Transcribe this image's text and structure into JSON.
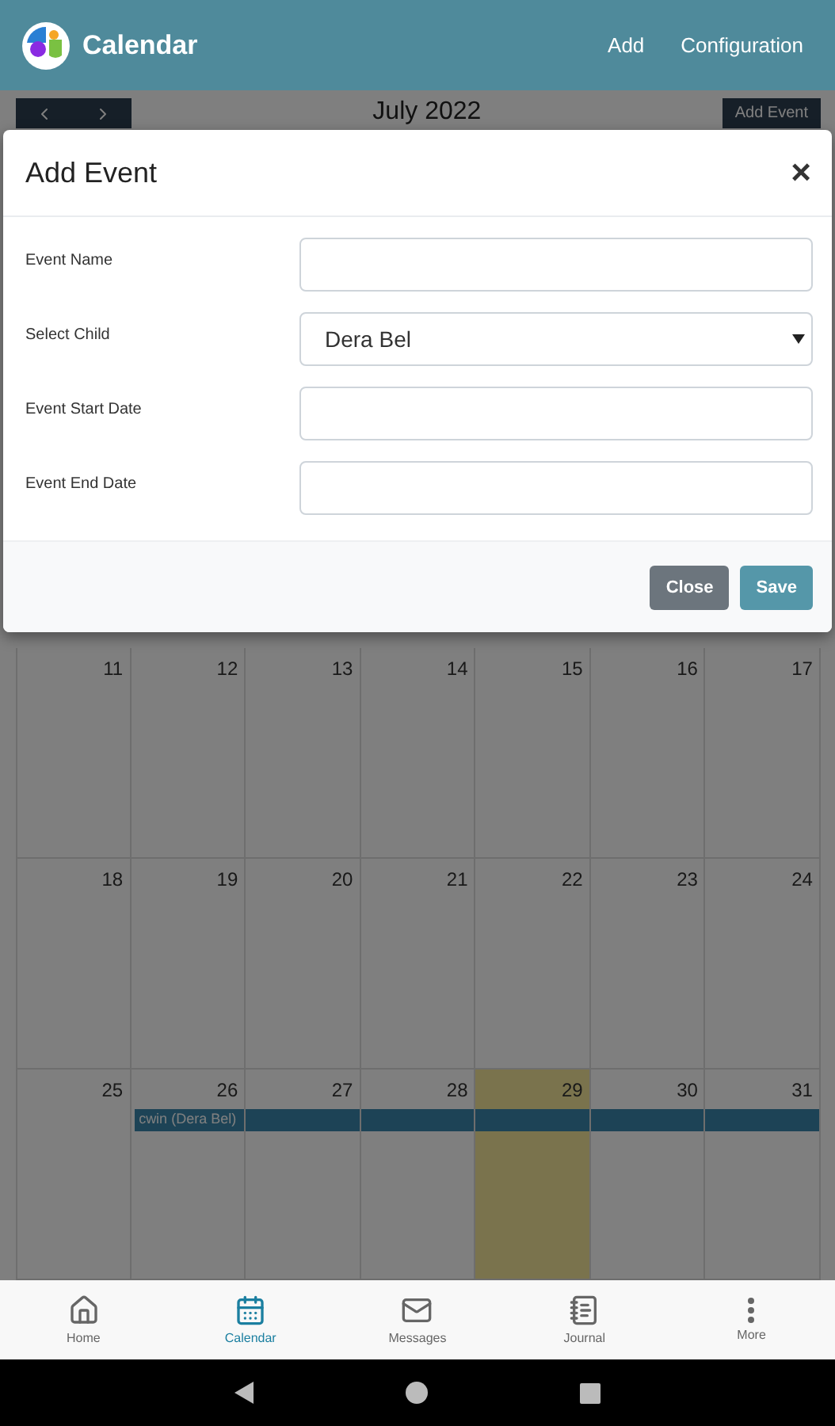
{
  "header": {
    "title": "Calendar",
    "actions": [
      "Add",
      "Configuration"
    ]
  },
  "calendar": {
    "month": "July 2022",
    "add_button": "Add Event",
    "weeks": [
      {
        "days": [
          {
            "day": "11",
            "today": false
          },
          {
            "day": "12",
            "today": false
          },
          {
            "day": "13",
            "today": false
          },
          {
            "day": "14",
            "today": false
          },
          {
            "day": "15",
            "today": false
          },
          {
            "day": "16",
            "today": false
          },
          {
            "day": "17",
            "today": false
          }
        ]
      },
      {
        "days": [
          {
            "day": "18",
            "today": false
          },
          {
            "day": "19",
            "today": false
          },
          {
            "day": "20",
            "today": false
          },
          {
            "day": "21",
            "today": false
          },
          {
            "day": "22",
            "today": false
          },
          {
            "day": "23",
            "today": false
          },
          {
            "day": "24",
            "today": false
          }
        ]
      },
      {
        "days": [
          {
            "day": "25",
            "today": false
          },
          {
            "day": "26",
            "today": false,
            "event": "cwin (Dera Bel)"
          },
          {
            "day": "27",
            "today": false
          },
          {
            "day": "28",
            "today": false
          },
          {
            "day": "29",
            "today": true
          },
          {
            "day": "30",
            "today": false
          },
          {
            "day": "31",
            "today": false
          }
        ]
      }
    ]
  },
  "modal": {
    "title": "Add Event",
    "close": "×",
    "fields": [
      {
        "label": "Event Name",
        "kind": "text"
      },
      {
        "label": "Select Child",
        "kind": "select",
        "value": "Dera Bel"
      },
      {
        "label": "Event Start Date",
        "kind": "text"
      },
      {
        "label": "Event End Date",
        "kind": "text"
      }
    ],
    "buttons": [
      {
        "label": "Close",
        "kind": "secondary"
      },
      {
        "label": "Save",
        "kind": "primary"
      }
    ]
  },
  "nav": [
    {
      "label": "Home",
      "selected": false
    },
    {
      "label": "Calendar",
      "selected": true
    },
    {
      "label": "Messages",
      "selected": false
    },
    {
      "label": "Journal",
      "selected": false
    },
    {
      "label": "More",
      "selected": false
    }
  ]
}
